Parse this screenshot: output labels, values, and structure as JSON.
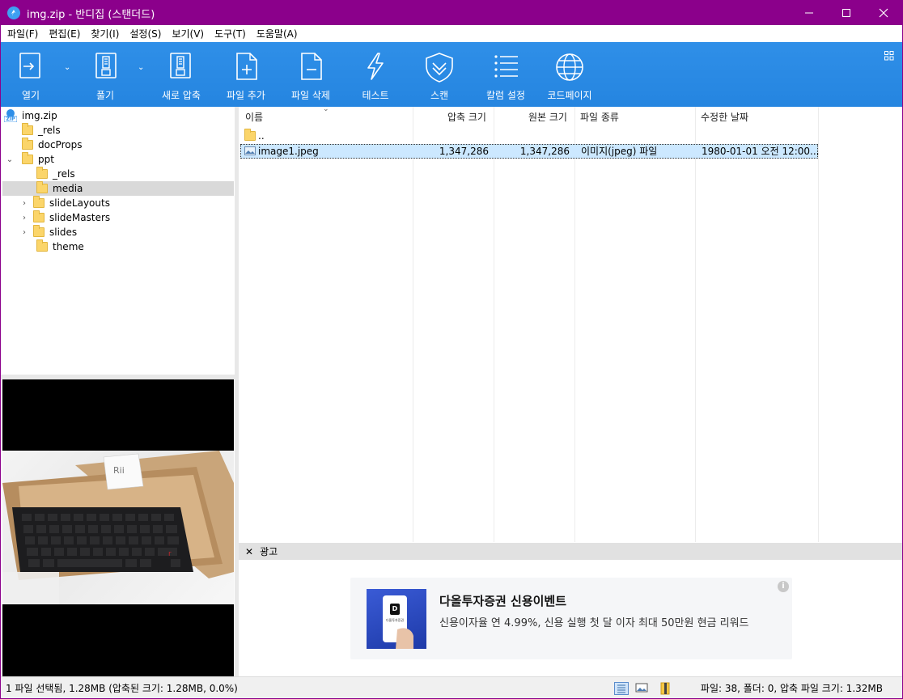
{
  "window": {
    "title": "img.zip - 반디집 (스탠더드)",
    "controls": {
      "minimize": "—",
      "maximize": "☐",
      "close": "✕"
    },
    "accent": "#8b008b"
  },
  "menu": [
    "파일(F)",
    "편집(E)",
    "찾기(I)",
    "설정(S)",
    "보기(V)",
    "도구(T)",
    "도움말(A)"
  ],
  "toolbar": {
    "open": "열기",
    "extract": "풀기",
    "new_archive": "새로 압축",
    "add_file": "파일 추가",
    "delete_file": "파일 삭제",
    "test": "테스트",
    "scan": "스캔",
    "column_settings": "칼럼 설정",
    "codepage": "코드페이지",
    "color": "#2f8fe8"
  },
  "tree": {
    "root": "img.zip",
    "root_badge": "ZIP",
    "items": [
      {
        "label": "_rels"
      },
      {
        "label": "docProps"
      },
      {
        "label": "ppt"
      },
      {
        "label": "_rels"
      },
      {
        "label": "media"
      },
      {
        "label": "slideLayouts"
      },
      {
        "label": "slideMasters"
      },
      {
        "label": "slides"
      },
      {
        "label": "theme"
      }
    ]
  },
  "list": {
    "columns": [
      "이름",
      "압축 크기",
      "원본 크기",
      "파일 종류",
      "수정한 날짜"
    ],
    "up_label": "..",
    "rows": [
      {
        "name": "image1.jpeg",
        "compressed": "1,347,286",
        "original": "1,347,286",
        "type": "이미지(jpeg) 파일",
        "modified": "1980-01-01 오전 12:00..."
      }
    ]
  },
  "preview": {
    "box_brand": "Rii"
  },
  "ad": {
    "close": "✕",
    "label": "광고",
    "title": "다올투자증권 신용이벤트",
    "text": "신용이자율 연 4.99%, 신용 실행 첫 달 이자 최대 50만원 현금 리워드",
    "info": "i",
    "app_brand": "다올투자증권",
    "app_letter": "D"
  },
  "status": {
    "left": "1 파일 선택됨, 1.28MB (압축된 크기: 1.28MB, 0.0%)",
    "right": "파일: 38, 폴더: 0, 압축 파일 크기: 1.32MB"
  }
}
